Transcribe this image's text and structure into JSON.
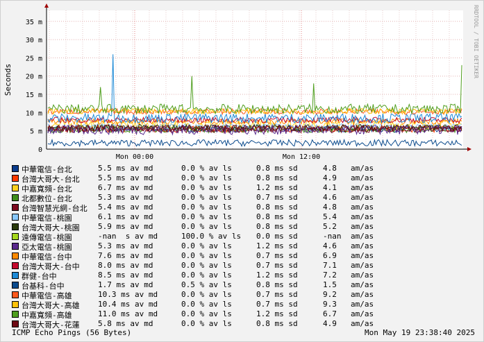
{
  "chart_data": {
    "type": "line",
    "ylabel": "Seconds",
    "y_ticks": [
      {
        "v": 0,
        "label": "0"
      },
      {
        "v": 5,
        "label": "5 m"
      },
      {
        "v": 10,
        "label": "10 m"
      },
      {
        "v": 15,
        "label": "15 m"
      },
      {
        "v": 20,
        "label": "20 m"
      },
      {
        "v": 25,
        "label": "25 m"
      },
      {
        "v": 30,
        "label": "30 m"
      },
      {
        "v": 35,
        "label": "35 m"
      }
    ],
    "ylim": [
      0,
      38
    ],
    "x_ticks": [
      "Mon 00:00",
      "Mon 12:00"
    ],
    "grid": true,
    "series": [
      {
        "name": "中華電信-台北",
        "color": "#0b3c8c",
        "avg": "5.5 ms av md",
        "loss": "0.0 % av ls",
        "sd": "0.8 ms sd",
        "extra": "4.8",
        "unit": "am/as"
      },
      {
        "name": "台灣大哥大-台北",
        "color": "#ff3a00",
        "avg": "5.5 ms av md",
        "loss": "0.0 % av ls",
        "sd": "0.8 ms sd",
        "extra": "4.9",
        "unit": "am/as"
      },
      {
        "name": "中嘉寬頻-台北",
        "color": "#ffd21f",
        "avg": "6.7 ms av md",
        "loss": "0.0 % av ls",
        "sd": "1.2 ms sd",
        "extra": "4.1",
        "unit": "am/as"
      },
      {
        "name": "北都數位-台北",
        "color": "#3f8e1b",
        "avg": "5.3 ms av md",
        "loss": "0.0 % av ls",
        "sd": "0.7 ms sd",
        "extra": "4.6",
        "unit": "am/as"
      },
      {
        "name": "台灣智慧光網-台北",
        "color": "#7d0a1f",
        "avg": "5.4 ms av md",
        "loss": "0.0 % av ls",
        "sd": "0.8 ms sd",
        "extra": "4.8",
        "unit": "am/as"
      },
      {
        "name": "中華電信-桃園",
        "color": "#88c8ff",
        "avg": "6.1 ms av md",
        "loss": "0.0 % av ls",
        "sd": "0.8 ms sd",
        "extra": "5.4",
        "unit": "am/as"
      },
      {
        "name": "台灣大哥大-桃園",
        "color": "#2a3a0c",
        "avg": "5.9 ms av md",
        "loss": "0.0 % av ls",
        "sd": "0.8 ms sd",
        "extra": "5.2",
        "unit": "am/as"
      },
      {
        "name": "遠傳電信-桃園",
        "color": "#a6d81e",
        "avg": "-nan  s av md",
        "loss": "100.0 % av ls",
        "sd": "0.0 ms sd",
        "extra": "-nan",
        "unit": "am/as"
      },
      {
        "name": "亞太電信-桃園",
        "color": "#5b2a8e",
        "avg": "5.3 ms av md",
        "loss": "0.0 % av ls",
        "sd": "1.2 ms sd",
        "extra": "4.6",
        "unit": "am/as"
      },
      {
        "name": "中華電信-台中",
        "color": "#ff8a00",
        "avg": "7.6 ms av md",
        "loss": "0.0 % av ls",
        "sd": "0.7 ms sd",
        "extra": "6.9",
        "unit": "am/as"
      },
      {
        "name": "台灣大哥大-台中",
        "color": "#c40a2e",
        "avg": "8.0 ms av md",
        "loss": "0.0 % av ls",
        "sd": "0.7 ms sd",
        "extra": "7.1",
        "unit": "am/as"
      },
      {
        "name": "群健-台中",
        "color": "#1e8ad6",
        "avg": "8.5 ms av md",
        "loss": "0.0 % av ls",
        "sd": "1.2 ms sd",
        "extra": "7.2",
        "unit": "am/as"
      },
      {
        "name": "台基科-台中",
        "color": "#0a4a8c",
        "avg": "1.7 ms av md",
        "loss": "0.5 % av ls",
        "sd": "0.8 ms sd",
        "extra": "1.5",
        "unit": "am/as"
      },
      {
        "name": "中華電信-高雄",
        "color": "#ff5a1e",
        "avg": "10.3 ms av md",
        "loss": "0.0 % av ls",
        "sd": "0.7 ms sd",
        "extra": "9.2",
        "unit": "am/as"
      },
      {
        "name": "台灣大哥大-高雄",
        "color": "#ffc20a",
        "avg": "10.4 ms av md",
        "loss": "0.0 % av ls",
        "sd": "0.7 ms sd",
        "extra": "9.3",
        "unit": "am/as"
      },
      {
        "name": "中嘉寬頻-高雄",
        "color": "#4f9e1e",
        "avg": "11.0 ms av md",
        "loss": "0.0 % av ls",
        "sd": "1.2 ms sd",
        "extra": "6.7",
        "unit": "am/as"
      },
      {
        "name": "台灣大哥大-花蓮",
        "color": "#6e0a14",
        "avg": "5.8 ms av md",
        "loss": "0.0 % av ls",
        "sd": "0.8 ms sd",
        "extra": "4.9",
        "unit": "am/as"
      }
    ]
  },
  "footer": {
    "title": "ICMP Echo Pings (56 Bytes)",
    "timestamp": "Mon May 19 23:38:40 2025"
  },
  "credit": "RRDTOOL / TOBI OETIKER"
}
